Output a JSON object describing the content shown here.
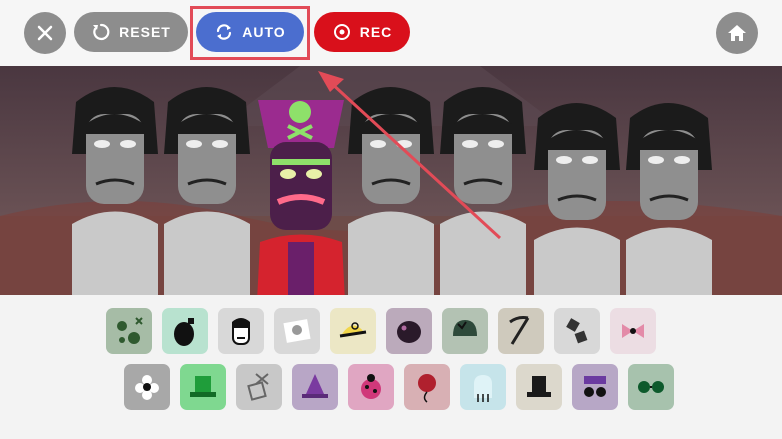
{
  "toolbar": {
    "close_icon": "close-icon",
    "reset_label": "RESET",
    "auto_label": "AUTO",
    "rec_label": "REC",
    "home_icon": "home-icon"
  },
  "colors": {
    "accent_blue": "#4b6ecf",
    "rec_red": "#d9101b",
    "gray_button": "#8d8d8d",
    "annotation_red": "#e24b57"
  },
  "stage": {
    "characters": [
      "performer-1",
      "performer-2",
      "pirate-performer-3",
      "performer-4",
      "performer-5",
      "performer-6",
      "performer-7"
    ]
  },
  "sound_icons": {
    "row1": [
      "bubbles-icon",
      "bomb-icon",
      "face-icon",
      "skull-note-icon",
      "cap-icon",
      "blob-icon",
      "helmet-icon",
      "scythe-icon",
      "hammers-icon",
      "bow-icon"
    ],
    "row2": [
      "flower-icon",
      "green-hat-icon",
      "crossed-box-icon",
      "witch-hat-icon",
      "ladybug-icon",
      "balloon-icon",
      "ghost-icon",
      "top-hat-icon",
      "goggles-hat-icon",
      "green-glasses-icon"
    ]
  }
}
